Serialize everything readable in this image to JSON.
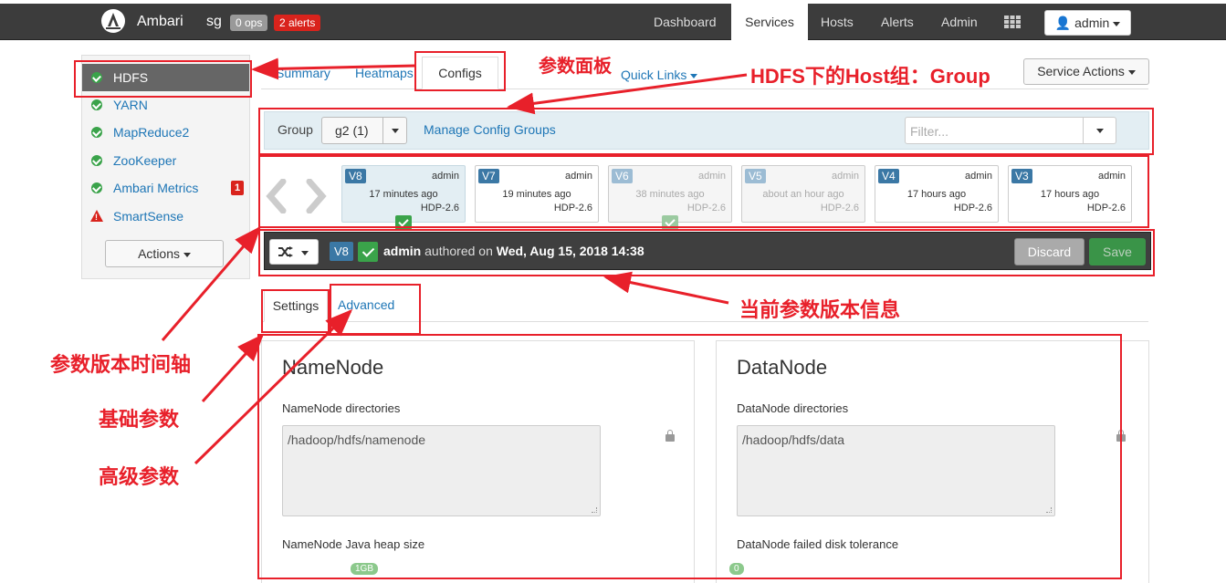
{
  "topbar": {
    "brand": "Ambari",
    "cluster": "sg",
    "ops_badge": "0 ops",
    "alerts_badge": "2 alerts",
    "nav": [
      "Dashboard",
      "Services",
      "Hosts",
      "Alerts",
      "Admin"
    ],
    "active_nav": "Services",
    "user": "admin"
  },
  "sidebar": {
    "items": [
      {
        "label": "HDFS",
        "status": "ok",
        "active": true
      },
      {
        "label": "YARN",
        "status": "ok"
      },
      {
        "label": "MapReduce2",
        "status": "ok"
      },
      {
        "label": "ZooKeeper",
        "status": "ok"
      },
      {
        "label": "Ambari Metrics",
        "status": "ok",
        "alert_count": "1"
      },
      {
        "label": "SmartSense",
        "status": "warning"
      }
    ],
    "actions_label": "Actions"
  },
  "service_tabs": {
    "summary": "Summary",
    "heatmaps": "Heatmaps",
    "configs": "Configs",
    "quick_links": "Quick Links",
    "service_actions": "Service Actions"
  },
  "group_bar": {
    "label": "Group",
    "selected": "g2 (1)",
    "manage": "Manage Config Groups",
    "filter_placeholder": "Filter..."
  },
  "versions": [
    {
      "id": "V8",
      "author": "admin",
      "ago": "17 minutes ago",
      "stack": "HDP-2.6",
      "state": "current",
      "checked": true
    },
    {
      "id": "V7",
      "author": "admin",
      "ago": "19 minutes ago",
      "stack": "HDP-2.6",
      "state": "normal"
    },
    {
      "id": "V6",
      "author": "admin",
      "ago": "38 minutes ago",
      "stack": "HDP-2.6",
      "state": "faded",
      "checked": true
    },
    {
      "id": "V5",
      "author": "admin",
      "ago": "about an hour ago",
      "stack": "HDP-2.6",
      "state": "faded"
    },
    {
      "id": "V4",
      "author": "admin",
      "ago": "17 hours ago",
      "stack": "HDP-2.6",
      "state": "normal"
    },
    {
      "id": "V3",
      "author": "admin",
      "ago": "17 hours ago",
      "stack": "HDP-2.6",
      "state": "normal"
    }
  ],
  "current_version": {
    "id": "V8",
    "author": "admin",
    "authored_on": "authored on",
    "date": "Wed, Aug 15, 2018 14:38",
    "discard": "Discard",
    "save": "Save"
  },
  "settings_tabs": {
    "settings": "Settings",
    "advanced": "Advanced"
  },
  "panels": {
    "namenode": {
      "title": "NameNode",
      "dir_label": "NameNode directories",
      "dir_value": "/hadoop/hdfs/namenode",
      "heap_label": "NameNode Java heap size",
      "heap_value": "1GB"
    },
    "datanode": {
      "title": "DataNode",
      "dir_label": "DataNode directories",
      "dir_value": "/hadoop/hdfs/data",
      "tolerance_label": "DataNode failed disk tolerance",
      "tolerance_value": "0"
    }
  },
  "annotations": {
    "config_panel": "参数面板",
    "host_group": "HDFS下的Host组：Group",
    "current_version_info": "当前参数版本信息",
    "version_timeline": "参数版本时间轴",
    "basic_params": "基础参数",
    "advanced_params": "高级参数"
  },
  "colors": {
    "annotation": "#e8202a",
    "link": "#1e76b6",
    "ok": "#3aa34a",
    "alert": "#d9231c"
  }
}
